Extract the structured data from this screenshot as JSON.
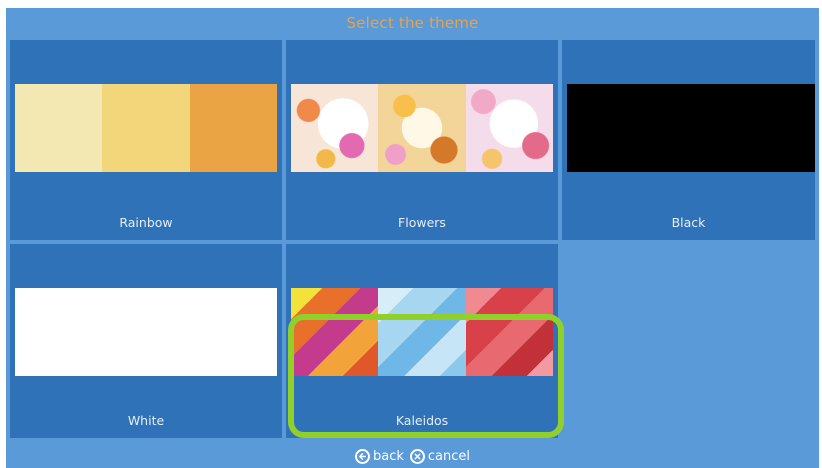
{
  "header": {
    "title": "Select the theme"
  },
  "themes": [
    {
      "label": "Rainbow",
      "colors": [
        "#f3e7b2",
        "#f4d67a",
        "#eba443"
      ]
    },
    {
      "label": "Flowers",
      "colors": [
        "#f7e6d8",
        "#f3d59a",
        "#f4dcea"
      ]
    },
    {
      "label": "Black",
      "colors": [
        "#000000"
      ]
    },
    {
      "label": "White",
      "colors": [
        "#ffffff"
      ]
    },
    {
      "label": "Kaleidos",
      "colors": [
        "#e8702a",
        "#a7d6f0",
        "#d8404a"
      ]
    }
  ],
  "selected_theme": "Kaleidos",
  "selection_color": "#8fd12a",
  "footer": {
    "back_label": "back",
    "cancel_label": "cancel"
  }
}
